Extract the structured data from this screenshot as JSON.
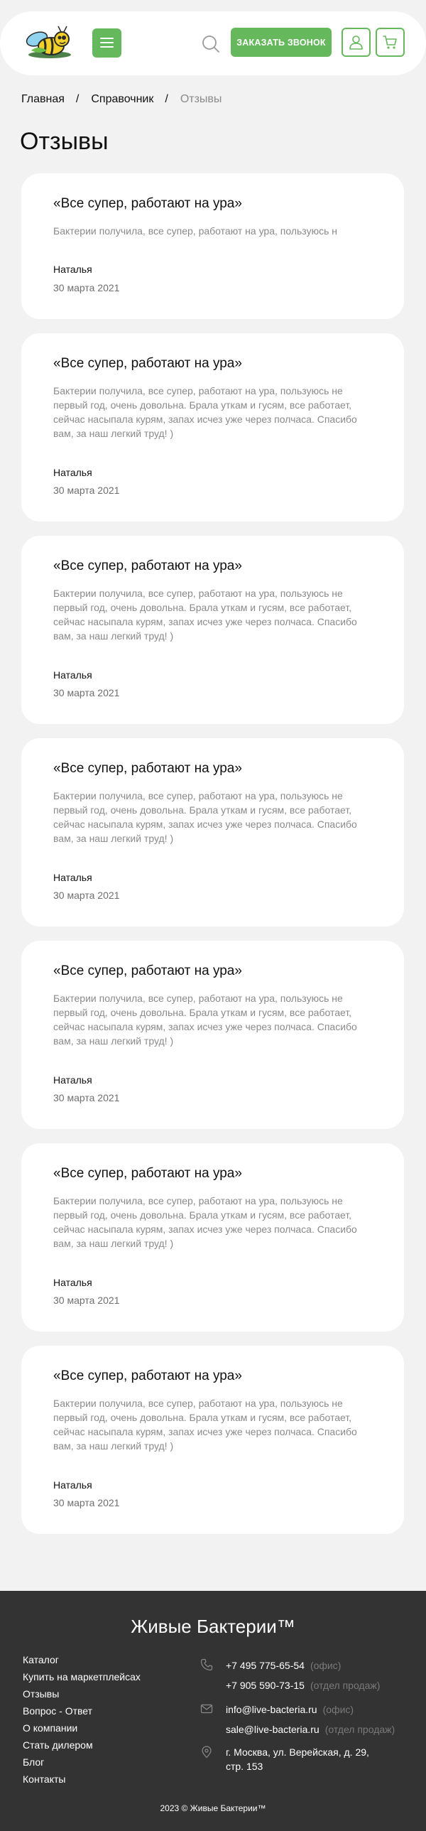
{
  "header": {
    "call_label": "ЗАКАЗАТЬ ЗВОНОК"
  },
  "breadcrumb": {
    "home": "Главная",
    "separator": "/",
    "section": "Справочник",
    "current": "Отзывы"
  },
  "page_title": "Отзывы",
  "reviews": [
    {
      "title": "«Все супер, работают на ура»",
      "text": "Бактерии получила, все супер, работают на ура, пользуюсь н",
      "author": "Наталья",
      "date": "30 марта 2021"
    },
    {
      "title": "«Все супер, работают на ура»",
      "text": "Бактерии получила, все супер, работают на ура, пользуюсь не первый год, очень довольна. Брала уткам и гусям, все работает, сейчас насыпала курям, запах исчез уже через полчаса. Спасибо вам, за наш легкий труд! )",
      "author": "Наталья",
      "date": "30 марта 2021"
    },
    {
      "title": "«Все супер, работают на ура»",
      "text": "Бактерии получила, все супер, работают на ура, пользуюсь не первый год, очень довольна. Брала уткам и гусям, все работает, сейчас насыпала курям, запах исчез уже через полчаса. Спасибо вам, за наш легкий труд! )",
      "author": "Наталья",
      "date": "30 марта 2021"
    },
    {
      "title": "«Все супер, работают на ура»",
      "text": "Бактерии получила, все супер, работают на ура, пользуюсь не первый год, очень довольна. Брала уткам и гусям, все работает, сейчас насыпала курям, запах исчез уже через полчаса. Спасибо вам, за наш легкий труд! )",
      "author": "Наталья",
      "date": "30 марта 2021"
    },
    {
      "title": "«Все супер, работают на ура»",
      "text": "Бактерии получила, все супер, работают на ура, пользуюсь не первый год, очень довольна. Брала уткам и гусям, все работает, сейчас насыпала курям, запах исчез уже через полчаса. Спасибо вам, за наш легкий труд! )",
      "author": "Наталья",
      "date": "30 марта 2021"
    },
    {
      "title": "«Все супер, работают на ура»",
      "text": "Бактерии получила, все супер, работают на ура, пользуюсь не первый год, очень довольна. Брала уткам и гусям, все работает, сейчас насыпала курям, запах исчез уже через полчаса. Спасибо вам, за наш легкий труд! )",
      "author": "Наталья",
      "date": "30 марта 2021"
    },
    {
      "title": "«Все супер, работают на ура»",
      "text": "Бактерии получила, все супер, работают на ура, пользуюсь не первый год, очень довольна. Брала уткам и гусям, все работает, сейчас насыпала курям, запах исчез уже через полчаса. Спасибо вам, за наш легкий труд! )",
      "author": "Наталья",
      "date": "30 марта 2021"
    }
  ],
  "footer": {
    "brand": "Живые Бактерии™",
    "nav": [
      "Каталог",
      "Купить на маркетплейсах",
      "Отзывы",
      "Вопрос - Ответ",
      "О компании",
      "Стать дилером",
      "Блог",
      "Контакты"
    ],
    "phones": [
      {
        "value": "+7 495 775-65-54",
        "note": "(офис)"
      },
      {
        "value": "+7 905 590-73-15",
        "note": "(отдел продаж)"
      }
    ],
    "emails": [
      {
        "value": "info@live-bacteria.ru",
        "note": "(офис)"
      },
      {
        "value": "sale@live-bacteria.ru",
        "note": "(отдел продаж)"
      }
    ],
    "address_line1": "г. Москва, ул. Верейская, д. 29,",
    "address_line2": "стр. 153",
    "copyright": "2023 © Живые Бактерии™"
  },
  "icons": {
    "logo": "bee-logo",
    "menu": "hamburger-icon",
    "search": "search-icon",
    "account": "user-icon",
    "cart": "cart-icon",
    "phone": "phone-icon",
    "mail": "mail-icon",
    "location": "location-pin-icon"
  },
  "colors": {
    "accent": "#66b85d",
    "page_bg": "#f2f2f2",
    "footer_bg": "#333333",
    "muted_text": "#8a8a8a"
  }
}
